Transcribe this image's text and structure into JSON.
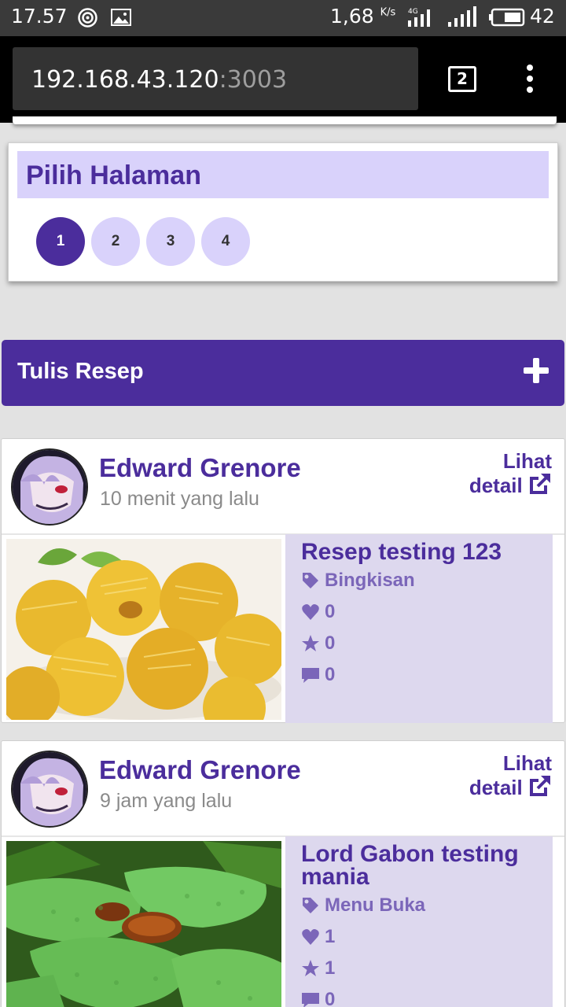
{
  "status_bar": {
    "time": "17.57",
    "speed": "1,68",
    "speed_unit": "K/s",
    "network": "4G",
    "battery": "42"
  },
  "browser": {
    "url_host": "192.168.43.120",
    "url_port": ":3003",
    "tab_count": "2"
  },
  "pagination": {
    "title": "Pilih Halaman",
    "pages": [
      "1",
      "2",
      "3",
      "4"
    ],
    "active_page": "1"
  },
  "write_recipe": {
    "label": "Tulis Resep"
  },
  "recipes": [
    {
      "author": "Edward Grenore",
      "time": "10 menit yang lalu",
      "detail_label_1": "Lihat",
      "detail_label_2": "detail",
      "title": "Resep testing 123",
      "category": "Bingkisan",
      "likes": "0",
      "rating": "0",
      "comments": "0"
    },
    {
      "author": "Edward Grenore",
      "time": "9 jam yang lalu",
      "detail_label_1": "Lihat",
      "detail_label_2": "detail",
      "title": "Lord Gabon testing mania",
      "category": "Menu Buka",
      "likes": "1",
      "rating": "1",
      "comments": "0"
    }
  ],
  "colors": {
    "primary": "#4b2d9c",
    "light_primary": "#d9d2fb",
    "panel": "#ddd8ee"
  }
}
